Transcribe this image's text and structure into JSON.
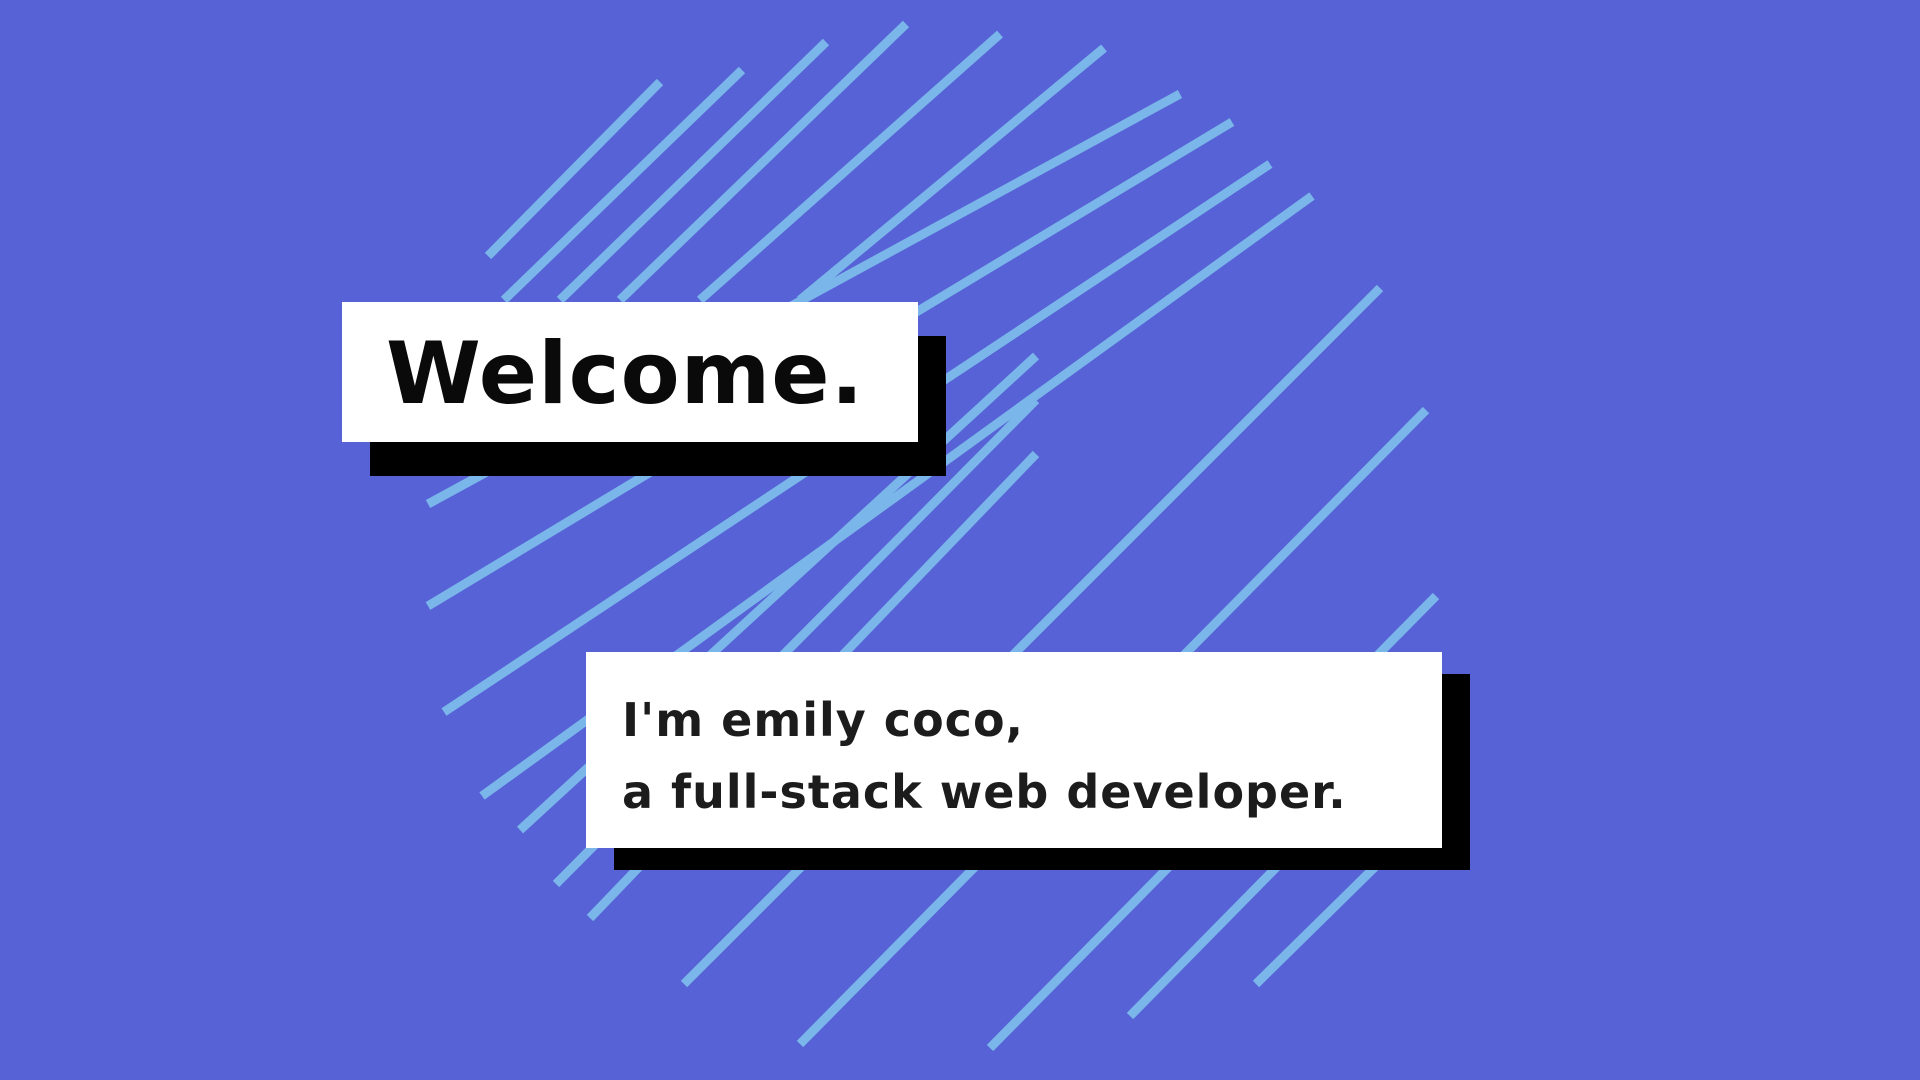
{
  "theme": {
    "background": "#5662d5",
    "stripe_color": "#7ab6ea",
    "card_background": "#ffffff",
    "card_shadow": "#000000"
  },
  "hero": {
    "welcome": "Welcome.",
    "intro_line_1": "I'm emily coco,",
    "intro_line_2": "a full-stack web developer."
  }
}
